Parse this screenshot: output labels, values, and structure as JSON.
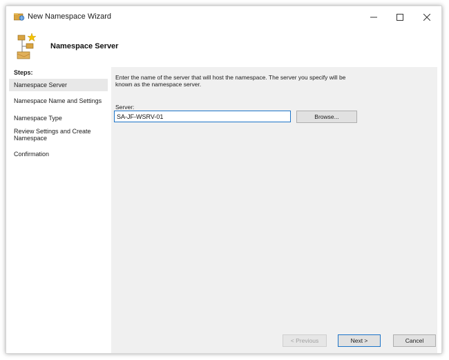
{
  "window": {
    "title": "New Namespace Wizard",
    "controls": {
      "minimize": "minimize",
      "maximize": "maximize",
      "close": "close"
    }
  },
  "header": {
    "title": "Namespace Server",
    "icon": "namespace-wizard-icon"
  },
  "steps": {
    "heading": "Steps:",
    "items": [
      {
        "label": "Namespace Server",
        "active": true
      },
      {
        "label": "Namespace Name and Settings",
        "active": false
      },
      {
        "label": "Namespace Type",
        "active": false
      },
      {
        "label": "Review Settings and Create Namespace",
        "active": false
      },
      {
        "label": "Confirmation",
        "active": false
      }
    ]
  },
  "main": {
    "instruction": "Enter the name of the server that will host the namespace. The server you specify will be known as the namespace server.",
    "server_label": "Server:",
    "server_value": "SA-JF-WSRV-01",
    "browse_label": "Browse..."
  },
  "footer": {
    "previous_label": "< Previous",
    "next_label": "Next >",
    "cancel_label": "Cancel"
  },
  "colors": {
    "accent": "#1a73c8",
    "content_bg": "#f0f0f0",
    "active_step_bg": "#e8e8e8",
    "button_bg": "#e1e1e1"
  }
}
